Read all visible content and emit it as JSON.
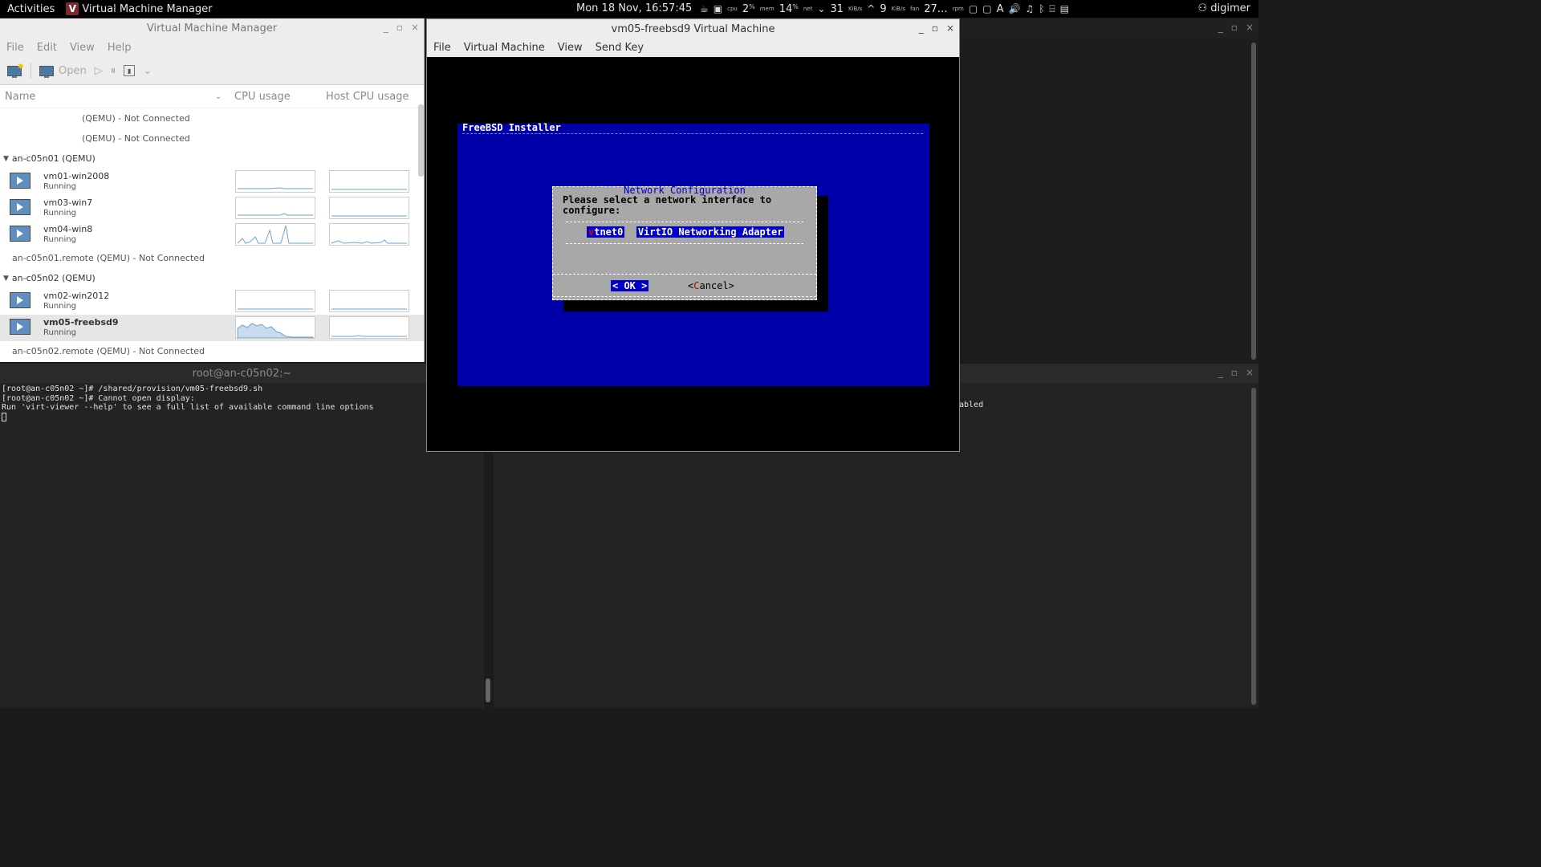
{
  "topbar": {
    "activities": "Activities",
    "app_name": "Virtual Machine Manager",
    "clock": "Mon 18 Nov, 16:57:45",
    "cpu_label": "cpu",
    "cpu_value": "2",
    "cpu_unit": "%",
    "mem_label": "mem",
    "mem_value": "14",
    "mem_unit": "%",
    "net_label": "net",
    "net_down": "31",
    "net_down_unit": "KiB/s",
    "net_up": "9",
    "net_up_unit": "KiB/s",
    "fan_label": "fan",
    "fan_value": "27…",
    "fan_unit": "rpm",
    "lang": "A",
    "user": "digimer"
  },
  "vmm": {
    "title": "Virtual Machine Manager",
    "menu": [
      "File",
      "Edit",
      "View",
      "Help"
    ],
    "toolbar_open": "Open",
    "columns": {
      "name": "Name",
      "cpu": "CPU usage",
      "host_cpu": "Host CPU usage"
    },
    "unnamed_connections": [
      "(QEMU) - Not Connected",
      "(QEMU) - Not Connected"
    ],
    "groups": [
      {
        "label": "an-c05n01 (QEMU)",
        "vms": [
          {
            "name": "vm01-win2008",
            "status": "Running"
          },
          {
            "name": "vm03-win7",
            "status": "Running"
          },
          {
            "name": "vm04-win8",
            "status": "Running"
          }
        ],
        "note": "an-c05n01.remote (QEMU) - Not Connected"
      },
      {
        "label": "an-c05n02 (QEMU)",
        "vms": [
          {
            "name": "vm02-win2012",
            "status": "Running"
          },
          {
            "name": "vm05-freebsd9",
            "status": "Running"
          }
        ],
        "note": "an-c05n02.remote (QEMU) - Not Connected"
      }
    ]
  },
  "terminal": {
    "title": "root@an-c05n02:~",
    "lines": [
      "[root@an-c05n02 ~]# /shared/provision/vm05-freebsd9.sh",
      "[root@an-c05n02 ~]# Cannot open display:",
      "Run 'virt-viewer --help' to see a full list of available command line options"
    ]
  },
  "right_terminal": {
    "visible_text": "abled"
  },
  "viewer": {
    "title": "vm05-freebsd9 Virtual Machine",
    "menu": [
      "File",
      "Virtual Machine",
      "View",
      "Send Key"
    ],
    "installer": {
      "header": "FreeBSD Installer",
      "dialog_title": "Network Configuration",
      "prompt": "Please select a network interface to configure:",
      "option_first": "v",
      "option_name_rest": "tnet0",
      "option_desc": "VirtIO Networking Adapter",
      "ok_label": "< OK >",
      "cancel_open": "<",
      "cancel_first": "C",
      "cancel_rest": "ancel>"
    }
  },
  "colors": {
    "installer_bg": "#0000a8",
    "dialog_bg": "#a8a8a8",
    "highlight": "#0000c8"
  }
}
